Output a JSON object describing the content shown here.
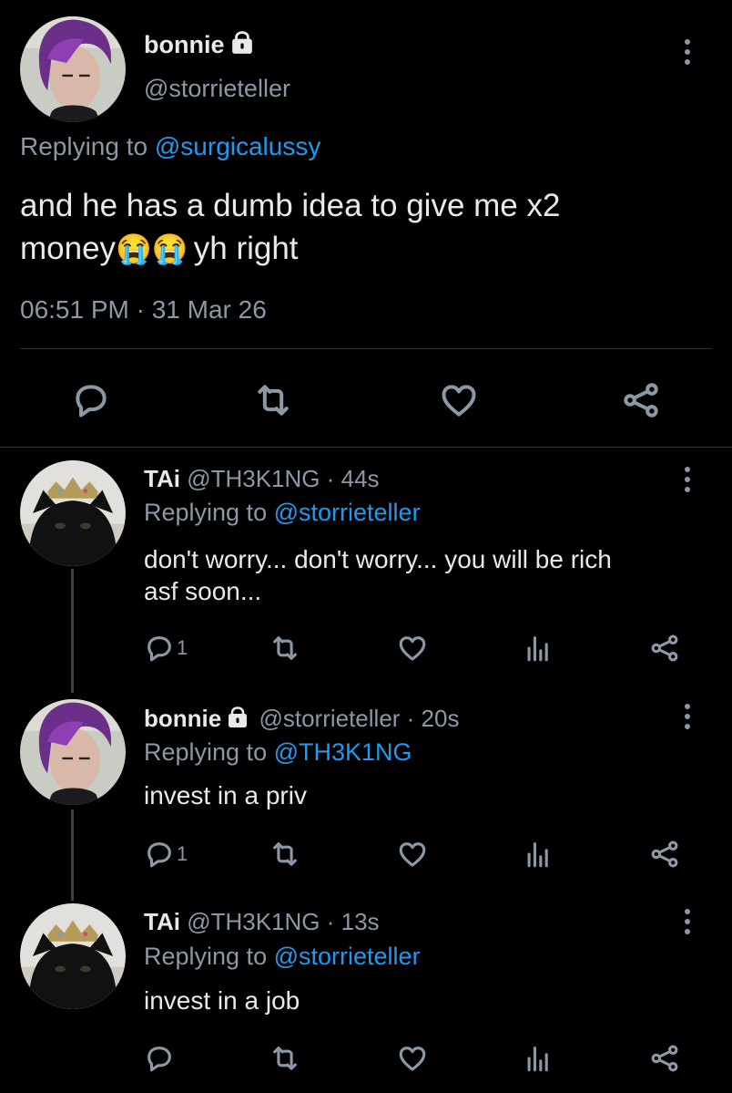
{
  "main_tweet": {
    "display_name": "bonnie",
    "handle": "@storrieteller",
    "replying_prefix": "Replying to",
    "replying_to": "@surgicalussy",
    "text_line1": "and he has a dumb idea to give me x2",
    "text_line2_pre": "money",
    "text_emoji": "😭😭",
    "text_line2_post": "yh right",
    "timestamp": "06:51 PM · 31 Mar 26"
  },
  "replies": [
    {
      "display_name": "TAi",
      "handle": "@TH3K1NG",
      "time": "· 44s",
      "replying_prefix": "Replying to",
      "replying_to": "@storrieteller",
      "text_line1": "don't worry... don't worry... you will be rich",
      "text_line2": "asf soon...",
      "reply_count": "1"
    },
    {
      "display_name": "bonnie",
      "handle": "@storrieteller",
      "time": "· 20s",
      "replying_prefix": "Replying to",
      "replying_to": "@TH3K1NG",
      "text_line1": "invest in a priv",
      "reply_count": "1"
    },
    {
      "display_name": "TAi",
      "handle": "@TH3K1NG",
      "time": "· 13s",
      "replying_prefix": "Replying to",
      "replying_to": "@storrieteller",
      "text_line1": "invest in a job",
      "reply_count": ""
    }
  ],
  "icons": [
    "lock-icon",
    "more-icon",
    "reply-icon",
    "retweet-icon",
    "like-icon",
    "analytics-icon",
    "share-icon"
  ],
  "colors": {
    "background": "#000000",
    "text": "#e7e9ea",
    "secondary": "#8b98a5",
    "link": "#1d9bf0",
    "divider": "#2f3336"
  }
}
